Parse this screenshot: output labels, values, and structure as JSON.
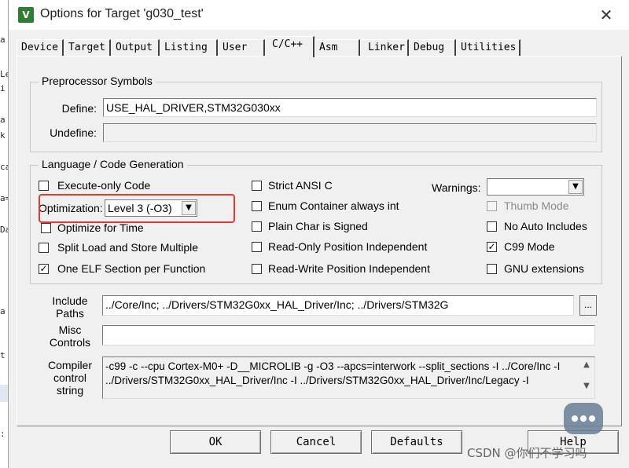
{
  "window": {
    "title": "Options for Target 'g030_test'",
    "icon_letter": "V",
    "close_glyph": "✕"
  },
  "tabs": [
    "Device",
    "Target",
    "Output",
    "Listing",
    "User",
    "C/C++",
    "Asm",
    "Linker",
    "Debug",
    "Utilities"
  ],
  "active_tab": "C/C++",
  "preprocessor": {
    "legend": "Preprocessor Symbols",
    "define_label": "Define:",
    "define_value": "USE_HAL_DRIVER,STM32G030xx",
    "undefine_label": "Undefine:",
    "undefine_value": ""
  },
  "language": {
    "legend": "Language / Code Generation",
    "execute_only": {
      "label": "Execute-only Code",
      "checked": false
    },
    "optimization_label": "Optimization:",
    "optimization_value": "Level 3 (-O3)",
    "optimize_time": {
      "label": "Optimize for Time",
      "checked": false
    },
    "split_load": {
      "label": "Split Load and Store Multiple",
      "checked": false
    },
    "one_elf": {
      "label": "One ELF Section per Function",
      "checked": true
    },
    "strict_ansi": {
      "label": "Strict ANSI C",
      "checked": false
    },
    "enum_container": {
      "label": "Enum Container always int",
      "checked": false
    },
    "plain_char": {
      "label": "Plain Char is Signed",
      "checked": false
    },
    "readonly_pos": {
      "label": "Read-Only Position Independent",
      "checked": false
    },
    "readwrite_pos": {
      "label": "Read-Write Position Independent",
      "checked": false
    },
    "warnings_label": "Warnings:",
    "warnings_value": "",
    "thumb_mode": {
      "label": "Thumb Mode",
      "checked": false,
      "disabled": true
    },
    "no_auto_includes": {
      "label": "No Auto Includes",
      "checked": false
    },
    "c99_mode": {
      "label": "C99 Mode",
      "checked": true
    },
    "gnu_ext": {
      "label": "GNU extensions",
      "checked": false
    },
    "check_glyph": "✓"
  },
  "include": {
    "label_line1": "Include",
    "label_line2": "Paths",
    "value": "../Core/Inc;                       ../Drivers/STM32G0xx_HAL_Driver/Inc;                        ../Drivers/STM32G",
    "browse": "..."
  },
  "misc": {
    "label_line1": "Misc",
    "label_line2": "Controls",
    "value": ""
  },
  "compiler": {
    "label_line1": "Compiler",
    "label_line2": "control",
    "label_line3": "string",
    "line1": "-c99 -c --cpu Cortex-M0+ -D__MICROLIB -g -O3 --apcs=interwork --split_sections -I ../Core/Inc -I",
    "line2": "../Drivers/STM32G0xx_HAL_Driver/Inc -I ../Drivers/STM32G0xx_HAL_Driver/Inc/Legacy -I",
    "scroll_up": "▲",
    "scroll_down": "▼"
  },
  "buttons": {
    "ok": "OK",
    "cancel": "Cancel",
    "defaults": "Defaults",
    "help": "Help"
  },
  "watermark": "CSDN @你们不学习吗",
  "dropdown_glyph": "▼",
  "colors": {
    "highlight": "#e53935",
    "dialog_bg": "#f0f0f0"
  }
}
